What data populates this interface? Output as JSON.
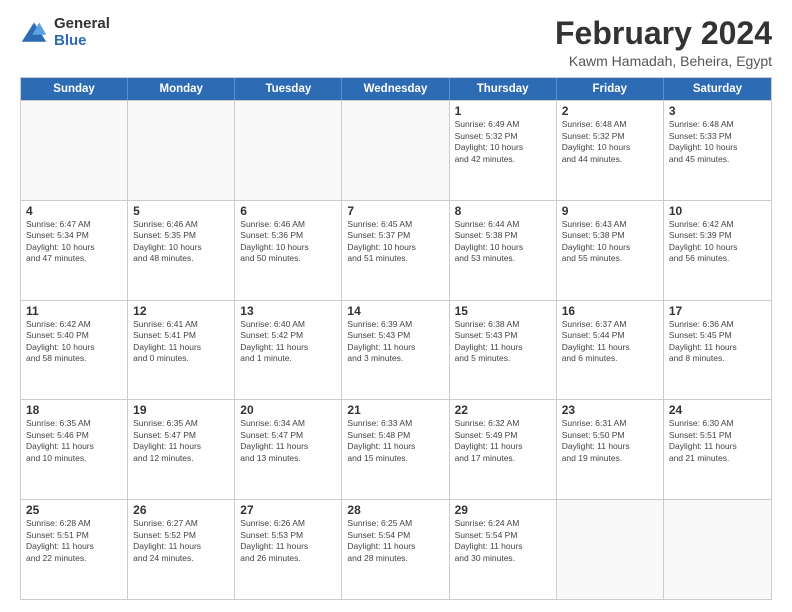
{
  "logo": {
    "general": "General",
    "blue": "Blue"
  },
  "header": {
    "title": "February 2024",
    "subtitle": "Kawm Hamadah, Beheira, Egypt"
  },
  "days_of_week": [
    "Sunday",
    "Monday",
    "Tuesday",
    "Wednesday",
    "Thursday",
    "Friday",
    "Saturday"
  ],
  "weeks": [
    [
      {
        "day": "",
        "info": ""
      },
      {
        "day": "",
        "info": ""
      },
      {
        "day": "",
        "info": ""
      },
      {
        "day": "",
        "info": ""
      },
      {
        "day": "1",
        "info": "Sunrise: 6:49 AM\nSunset: 5:32 PM\nDaylight: 10 hours\nand 42 minutes."
      },
      {
        "day": "2",
        "info": "Sunrise: 6:48 AM\nSunset: 5:32 PM\nDaylight: 10 hours\nand 44 minutes."
      },
      {
        "day": "3",
        "info": "Sunrise: 6:48 AM\nSunset: 5:33 PM\nDaylight: 10 hours\nand 45 minutes."
      }
    ],
    [
      {
        "day": "4",
        "info": "Sunrise: 6:47 AM\nSunset: 5:34 PM\nDaylight: 10 hours\nand 47 minutes."
      },
      {
        "day": "5",
        "info": "Sunrise: 6:46 AM\nSunset: 5:35 PM\nDaylight: 10 hours\nand 48 minutes."
      },
      {
        "day": "6",
        "info": "Sunrise: 6:46 AM\nSunset: 5:36 PM\nDaylight: 10 hours\nand 50 minutes."
      },
      {
        "day": "7",
        "info": "Sunrise: 6:45 AM\nSunset: 5:37 PM\nDaylight: 10 hours\nand 51 minutes."
      },
      {
        "day": "8",
        "info": "Sunrise: 6:44 AM\nSunset: 5:38 PM\nDaylight: 10 hours\nand 53 minutes."
      },
      {
        "day": "9",
        "info": "Sunrise: 6:43 AM\nSunset: 5:38 PM\nDaylight: 10 hours\nand 55 minutes."
      },
      {
        "day": "10",
        "info": "Sunrise: 6:42 AM\nSunset: 5:39 PM\nDaylight: 10 hours\nand 56 minutes."
      }
    ],
    [
      {
        "day": "11",
        "info": "Sunrise: 6:42 AM\nSunset: 5:40 PM\nDaylight: 10 hours\nand 58 minutes."
      },
      {
        "day": "12",
        "info": "Sunrise: 6:41 AM\nSunset: 5:41 PM\nDaylight: 11 hours\nand 0 minutes."
      },
      {
        "day": "13",
        "info": "Sunrise: 6:40 AM\nSunset: 5:42 PM\nDaylight: 11 hours\nand 1 minute."
      },
      {
        "day": "14",
        "info": "Sunrise: 6:39 AM\nSunset: 5:43 PM\nDaylight: 11 hours\nand 3 minutes."
      },
      {
        "day": "15",
        "info": "Sunrise: 6:38 AM\nSunset: 5:43 PM\nDaylight: 11 hours\nand 5 minutes."
      },
      {
        "day": "16",
        "info": "Sunrise: 6:37 AM\nSunset: 5:44 PM\nDaylight: 11 hours\nand 6 minutes."
      },
      {
        "day": "17",
        "info": "Sunrise: 6:36 AM\nSunset: 5:45 PM\nDaylight: 11 hours\nand 8 minutes."
      }
    ],
    [
      {
        "day": "18",
        "info": "Sunrise: 6:35 AM\nSunset: 5:46 PM\nDaylight: 11 hours\nand 10 minutes."
      },
      {
        "day": "19",
        "info": "Sunrise: 6:35 AM\nSunset: 5:47 PM\nDaylight: 11 hours\nand 12 minutes."
      },
      {
        "day": "20",
        "info": "Sunrise: 6:34 AM\nSunset: 5:47 PM\nDaylight: 11 hours\nand 13 minutes."
      },
      {
        "day": "21",
        "info": "Sunrise: 6:33 AM\nSunset: 5:48 PM\nDaylight: 11 hours\nand 15 minutes."
      },
      {
        "day": "22",
        "info": "Sunrise: 6:32 AM\nSunset: 5:49 PM\nDaylight: 11 hours\nand 17 minutes."
      },
      {
        "day": "23",
        "info": "Sunrise: 6:31 AM\nSunset: 5:50 PM\nDaylight: 11 hours\nand 19 minutes."
      },
      {
        "day": "24",
        "info": "Sunrise: 6:30 AM\nSunset: 5:51 PM\nDaylight: 11 hours\nand 21 minutes."
      }
    ],
    [
      {
        "day": "25",
        "info": "Sunrise: 6:28 AM\nSunset: 5:51 PM\nDaylight: 11 hours\nand 22 minutes."
      },
      {
        "day": "26",
        "info": "Sunrise: 6:27 AM\nSunset: 5:52 PM\nDaylight: 11 hours\nand 24 minutes."
      },
      {
        "day": "27",
        "info": "Sunrise: 6:26 AM\nSunset: 5:53 PM\nDaylight: 11 hours\nand 26 minutes."
      },
      {
        "day": "28",
        "info": "Sunrise: 6:25 AM\nSunset: 5:54 PM\nDaylight: 11 hours\nand 28 minutes."
      },
      {
        "day": "29",
        "info": "Sunrise: 6:24 AM\nSunset: 5:54 PM\nDaylight: 11 hours\nand 30 minutes."
      },
      {
        "day": "",
        "info": ""
      },
      {
        "day": "",
        "info": ""
      }
    ]
  ]
}
